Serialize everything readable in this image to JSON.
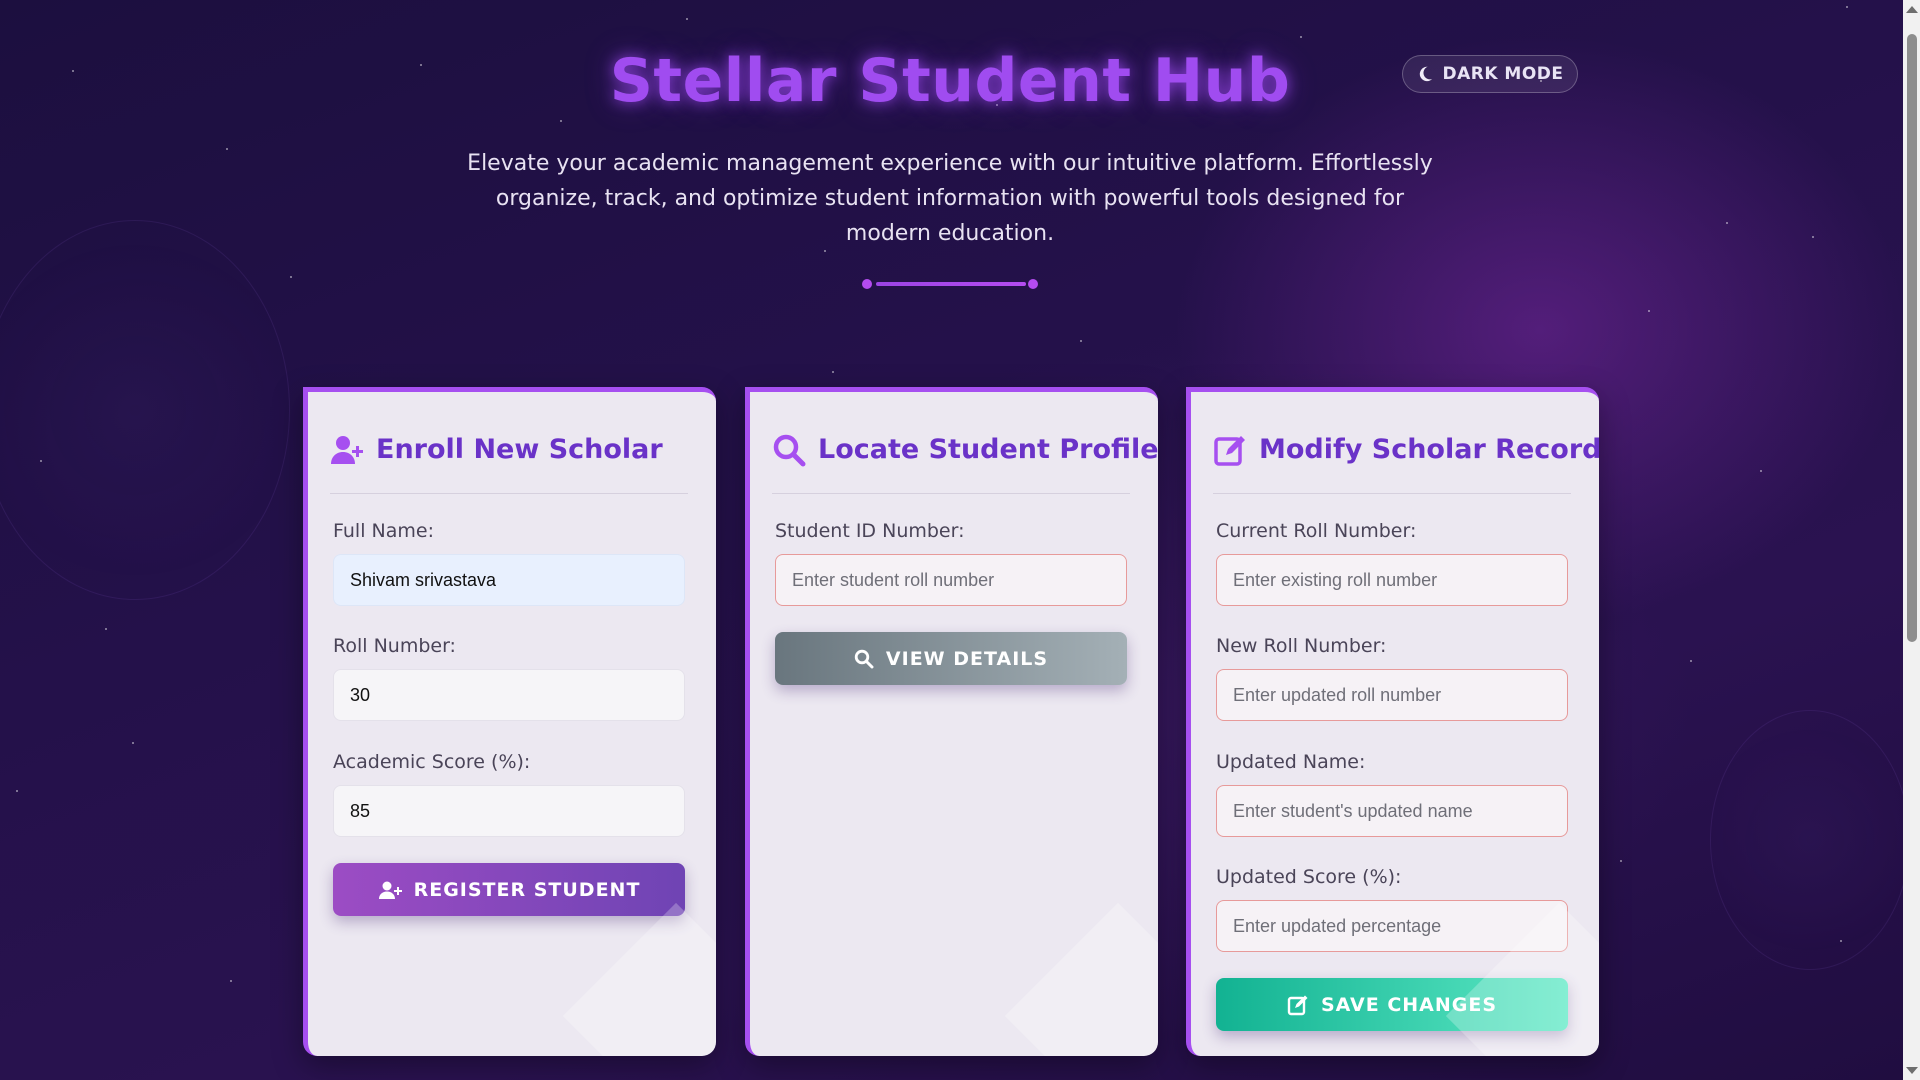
{
  "header": {
    "title": "Stellar Student Hub",
    "subtitle": "Elevate your academic management experience with our intuitive platform. Effortlessly organize, track, and optimize student information with powerful tools designed for modern education.",
    "mode_toggle_label": "DARK MODE",
    "mode_toggle_icon": "moon-icon"
  },
  "colors": {
    "accent": "#a64ff0",
    "title": "#a04cf0",
    "card_heading": "#6a32c8",
    "save_button": "#12b292"
  },
  "enroll": {
    "title": "Enroll New Scholar",
    "icon": "user-plus-icon",
    "full_name_label": "Full Name:",
    "full_name_value": "Shivam srivastava",
    "roll_label": "Roll Number:",
    "roll_value": "30",
    "score_label": "Academic Score (%):",
    "score_value": "85",
    "button_label": "REGISTER STUDENT"
  },
  "locate": {
    "title": "Locate Student Profile",
    "icon": "search-icon",
    "id_label": "Student ID Number:",
    "id_placeholder": "Enter student roll number",
    "button_label": "VIEW DETAILS"
  },
  "modify": {
    "title": "Modify Scholar Records",
    "icon": "edit-icon",
    "current_roll_label": "Current Roll Number:",
    "current_roll_placeholder": "Enter existing roll number",
    "new_roll_label": "New Roll Number:",
    "new_roll_placeholder": "Enter updated roll number",
    "name_label": "Updated Name:",
    "name_placeholder": "Enter student's updated name",
    "score_label": "Updated Score (%):",
    "score_placeholder": "Enter updated percentage",
    "button_label": "SAVE CHANGES"
  }
}
